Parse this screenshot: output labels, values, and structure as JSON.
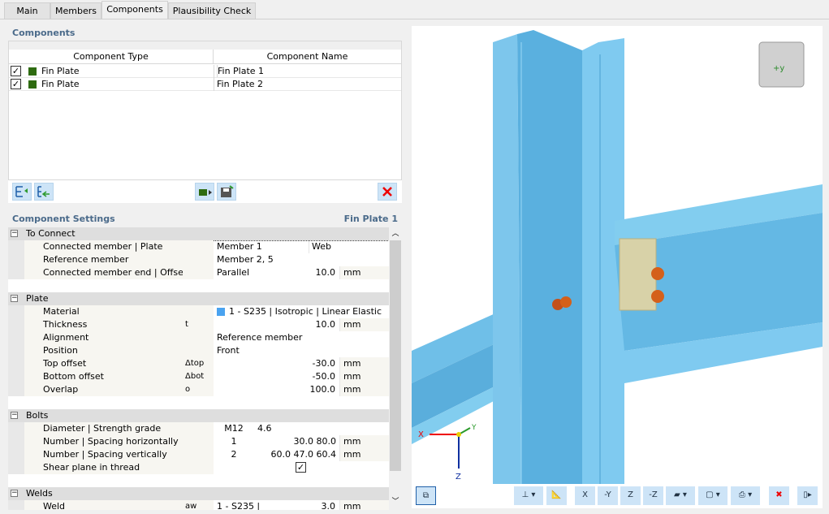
{
  "tabs": [
    {
      "label": "Main"
    },
    {
      "label": "Members"
    },
    {
      "label": "Components",
      "active": true
    },
    {
      "label": "Plausibility Check"
    }
  ],
  "components": {
    "title": "Components",
    "columns": [
      "Component Type",
      "Component Name"
    ],
    "rows": [
      {
        "checked": true,
        "type": "Fin Plate",
        "name": "Fin Plate 1",
        "color": "#2e6b10"
      },
      {
        "checked": true,
        "type": "Fin Plate",
        "name": "Fin Plate 2",
        "color": "#2e6b10"
      }
    ],
    "toolbar": [
      "move-up-icon",
      "move-down-icon",
      "library-icon",
      "save-icon",
      "delete-icon"
    ]
  },
  "settings": {
    "title": "Component Settings",
    "current": "Fin Plate 1",
    "groups": [
      {
        "label": "To Connect",
        "rows": [
          {
            "label": "Connected member | Plate",
            "sym": "",
            "v1": "Member 1",
            "v2": "Web",
            "unit": ""
          },
          {
            "label": "Reference member",
            "sym": "",
            "v1": "Member 2, 5",
            "v2": "",
            "unit": ""
          },
          {
            "label": "Connected member end | Offset",
            "sym": "",
            "v1": "Parallel",
            "v2": "10.0",
            "unit": "mm"
          }
        ]
      },
      {
        "label": "Plate",
        "rows": [
          {
            "label": "Material",
            "sym": "",
            "v1": "1 - S235 | Isotropic | Linear Elastic",
            "v2": "",
            "unit": "",
            "swatch": "#4aa3f0"
          },
          {
            "label": "Thickness",
            "sym": "t",
            "v1": "",
            "v2": "10.0",
            "unit": "mm"
          },
          {
            "label": "Alignment",
            "sym": "",
            "v1": "Reference member",
            "v2": "",
            "unit": ""
          },
          {
            "label": "Position",
            "sym": "",
            "v1": "Front",
            "v2": "",
            "unit": ""
          },
          {
            "label": "Top offset",
            "sym": "Δtop",
            "v1": "",
            "v2": "-30.0",
            "unit": "mm"
          },
          {
            "label": "Bottom offset",
            "sym": "Δbot",
            "v1": "",
            "v2": "-50.0",
            "unit": "mm"
          },
          {
            "label": "Overlap",
            "sym": "o",
            "v1": "",
            "v2": "100.0",
            "unit": "mm"
          }
        ]
      },
      {
        "label": "Bolts",
        "rows": [
          {
            "label": "Diameter | Strength grade",
            "sym": "",
            "v1": "M12",
            "v2": "4.6",
            "unit": "",
            "center": true
          },
          {
            "label": "Number | Spacing horizontally",
            "sym": "",
            "v1": "1",
            "v2": "30.0 80.0",
            "unit": "mm",
            "center": true
          },
          {
            "label": "Number | Spacing vertically",
            "sym": "",
            "v1": "2",
            "v2": "60.0 47.0 60.4",
            "unit": "mm",
            "center": true
          },
          {
            "label": "Shear plane in thread",
            "sym": "",
            "v1": "",
            "v2": "",
            "unit": "",
            "check": true
          }
        ]
      },
      {
        "label": "Welds",
        "rows": [
          {
            "label": "Weld",
            "sym": "aw",
            "v1": "1 - S235 |",
            "v2": "3.0",
            "unit": "mm"
          }
        ]
      }
    ]
  },
  "view": {
    "cube_label": "+y",
    "axes": {
      "x": "X",
      "y": "Y",
      "z": "Z"
    },
    "toolbar": [
      "render-toggle",
      "axis-system",
      "measure",
      "view-x",
      "view-minus-y",
      "view-z",
      "view-minus-z",
      "display-mode",
      "transparency",
      "print",
      "zoom-reset",
      "panel-toggle"
    ],
    "view_labels": {
      "x": "X",
      "my": "-Y",
      "z": "Z",
      "mz": "-Z"
    }
  }
}
